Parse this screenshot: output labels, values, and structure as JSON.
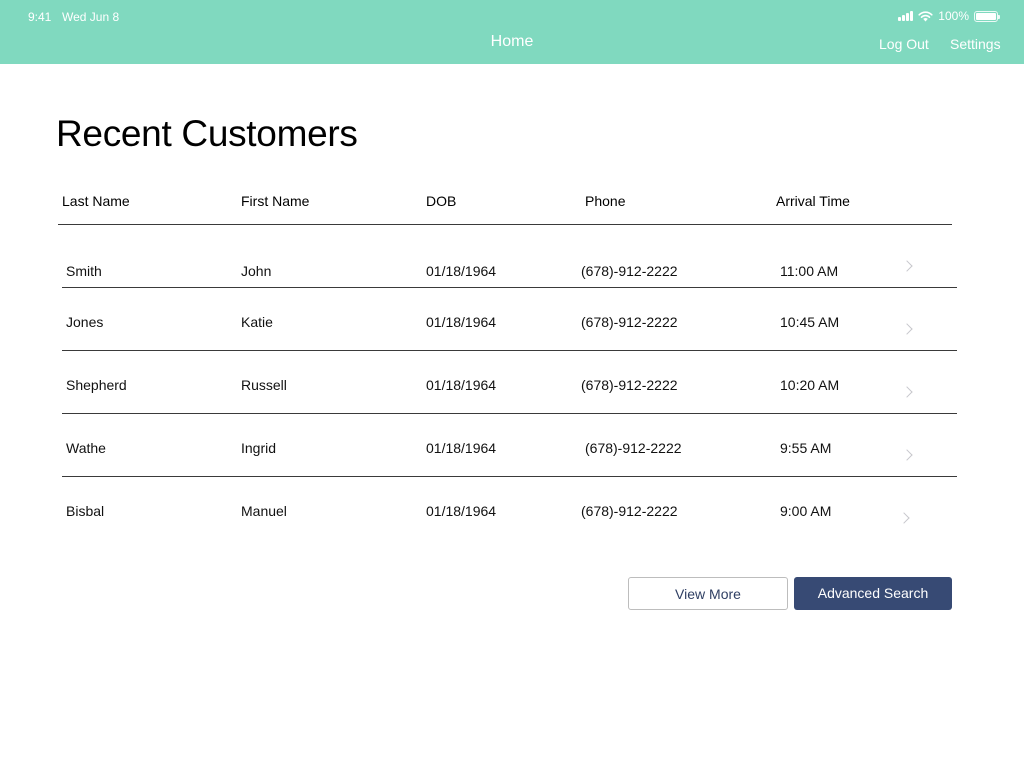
{
  "status": {
    "time": "9:41",
    "date": "Wed Jun 8",
    "battery": "100%",
    "battery_level": 1.0
  },
  "nav": {
    "title": "Home",
    "log_out": "Log Out",
    "settings": "Settings",
    "color": "#80d9bf"
  },
  "page": {
    "title": "Recent Customers"
  },
  "table": {
    "headers": {
      "last": "Last Name",
      "first": "First Name",
      "dob": "DOB",
      "phone": "Phone",
      "arrival": "Arrival Time"
    },
    "rows": [
      {
        "last": "Smith",
        "first": "John",
        "dob": "01/18/1964",
        "phone": "(678)-912-2222",
        "arrival": "11:00 AM"
      },
      {
        "last": "Jones",
        "first": "Katie",
        "dob": "01/18/1964",
        "phone": "(678)-912-2222",
        "arrival": "10:45 AM"
      },
      {
        "last": "Shepherd",
        "first": "Russell",
        "dob": "01/18/1964",
        "phone": "(678)-912-2222",
        "arrival": "10:20 AM"
      },
      {
        "last": "Wathe",
        "first": "Ingrid",
        "dob": "01/18/1964",
        "phone": "(678)-912-2222",
        "arrival": "9:55 AM"
      },
      {
        "last": "Bisbal",
        "first": "Manuel",
        "dob": "01/18/1964",
        "phone": "(678)-912-2222",
        "arrival": "9:00 AM"
      }
    ]
  },
  "actions": {
    "view_more": "View More",
    "advanced_search": "Advanced Search",
    "primary_color": "#374a74"
  },
  "icons": {
    "signal": "cellular-signal-icon",
    "wifi": "wifi-icon",
    "battery": "battery-icon",
    "row_disclosure": "chevron-right-icon"
  }
}
